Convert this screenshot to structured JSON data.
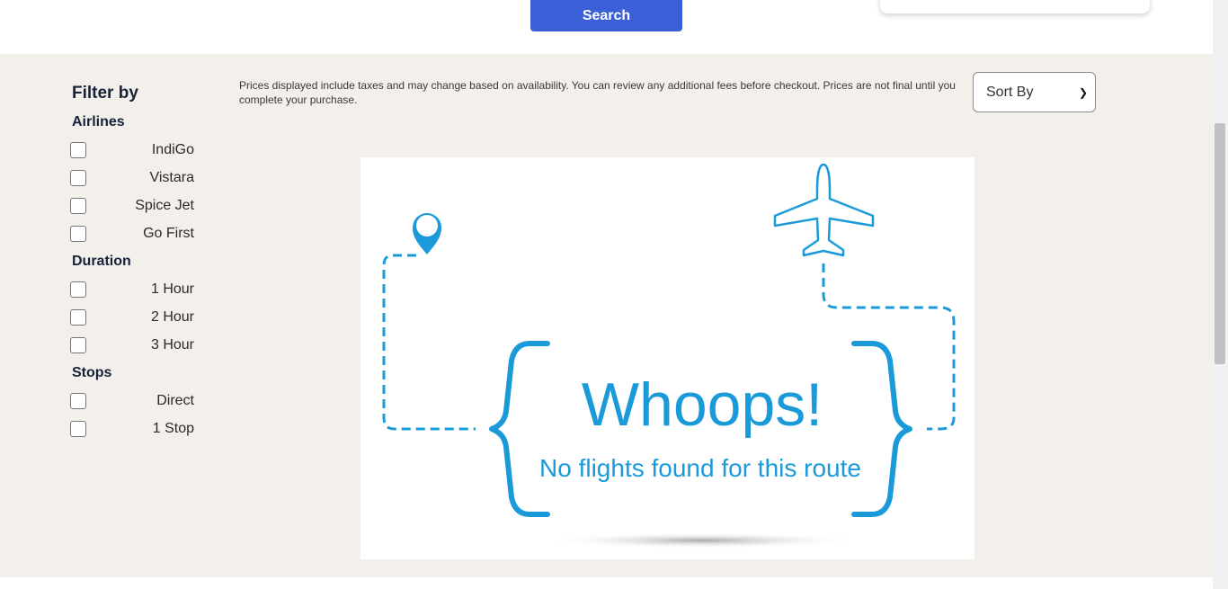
{
  "header": {
    "search_label": "Search"
  },
  "filters": {
    "title": "Filter by",
    "airlines": {
      "title": "Airlines",
      "options": [
        "IndiGo",
        "Vistara",
        "Spice Jet",
        "Go First"
      ]
    },
    "duration": {
      "title": "Duration",
      "options": [
        "1 Hour",
        "2 Hour",
        "3 Hour"
      ]
    },
    "stops": {
      "title": "Stops",
      "options": [
        "Direct",
        "1 Stop"
      ]
    }
  },
  "results": {
    "notice": "Prices displayed include taxes and may change based on availability. You can review any additional fees before checkout. Prices are not final until you complete your purchase.",
    "sort_label": "Sort By",
    "empty_title": "Whoops!",
    "empty_subtitle": "No flights found for this route"
  },
  "colors": {
    "accent": "#3a5fd6",
    "illustration_blue": "#1a9ad9",
    "page_bg": "#f3efea"
  },
  "icons": [
    "location-pin-icon",
    "airplane-icon",
    "chevron-down-icon"
  ]
}
